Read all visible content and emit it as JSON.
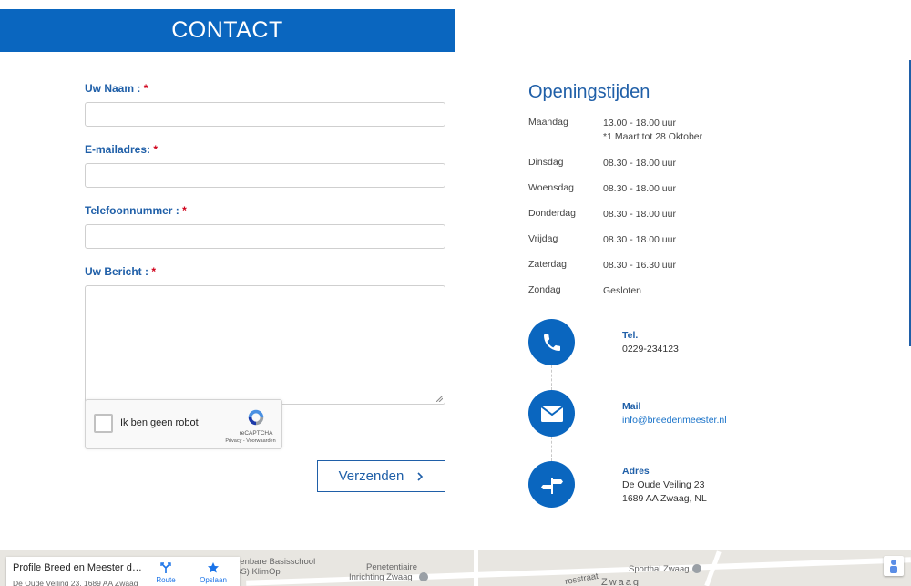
{
  "header": {
    "title": "CONTACT"
  },
  "form": {
    "name_label": "Uw Naam :",
    "email_label": "E-mailadres:",
    "phone_label": "Telefoonnummer :",
    "message_label": "Uw Bericht :",
    "required_mark": "*",
    "name_value": "",
    "email_value": "",
    "phone_value": "",
    "message_value": "",
    "submit_label": "Verzenden",
    "submit_icon": "chevron-right-icon"
  },
  "captcha": {
    "checkbox_label": "Ik ben geen robot",
    "brand": "reCAPTCHA",
    "links": "Privacy - Voorwaarden"
  },
  "hours": {
    "title": "Openingstijden",
    "rows": [
      {
        "day": "Maandag",
        "time": "13.00 - 18.00 uur",
        "note": "*1 Maart tot 28 Oktober"
      },
      {
        "day": "Dinsdag",
        "time": "08.30 - 18.00 uur"
      },
      {
        "day": "Woensdag",
        "time": "08.30 - 18.00 uur"
      },
      {
        "day": "Donderdag",
        "time": "08.30 - 18.00 uur"
      },
      {
        "day": "Vrijdag",
        "time": "08.30 - 18.00 uur"
      },
      {
        "day": "Zaterdag",
        "time": "08.30 - 16.30 uur"
      },
      {
        "day": "Zondag",
        "time": "Gesloten"
      }
    ]
  },
  "contact": {
    "phone": {
      "label": "Tel.",
      "value": "0229-234123",
      "icon": "phone-icon"
    },
    "mail": {
      "label": "Mail",
      "value": "info@breedenmeester.nl",
      "icon": "envelope-icon"
    },
    "address": {
      "label": "Adres",
      "line1": "De Oude Veiling 23",
      "line2": "1689 AA Zwaag, NL",
      "icon": "signpost-icon"
    }
  },
  "map": {
    "place_title": "Profile Breed en Meester de Fi...",
    "place_address": "De Oude Veiling 23, 1689 AA Zwaag",
    "route_label": "Route",
    "save_label": "Opslaan",
    "labels": {
      "school": "penbare Basisschool",
      "school2": "BS) KlimOp",
      "penitentiaire": "Penetentiaire",
      "inrichting": "Inrichting Zwaag",
      "street": "rosstraat",
      "sporthal": "Sporthal Zwaag",
      "town": "Zwaag"
    }
  },
  "colors": {
    "primary": "#0a66bf",
    "label": "#1f5fa8",
    "required": "#d0021b"
  }
}
